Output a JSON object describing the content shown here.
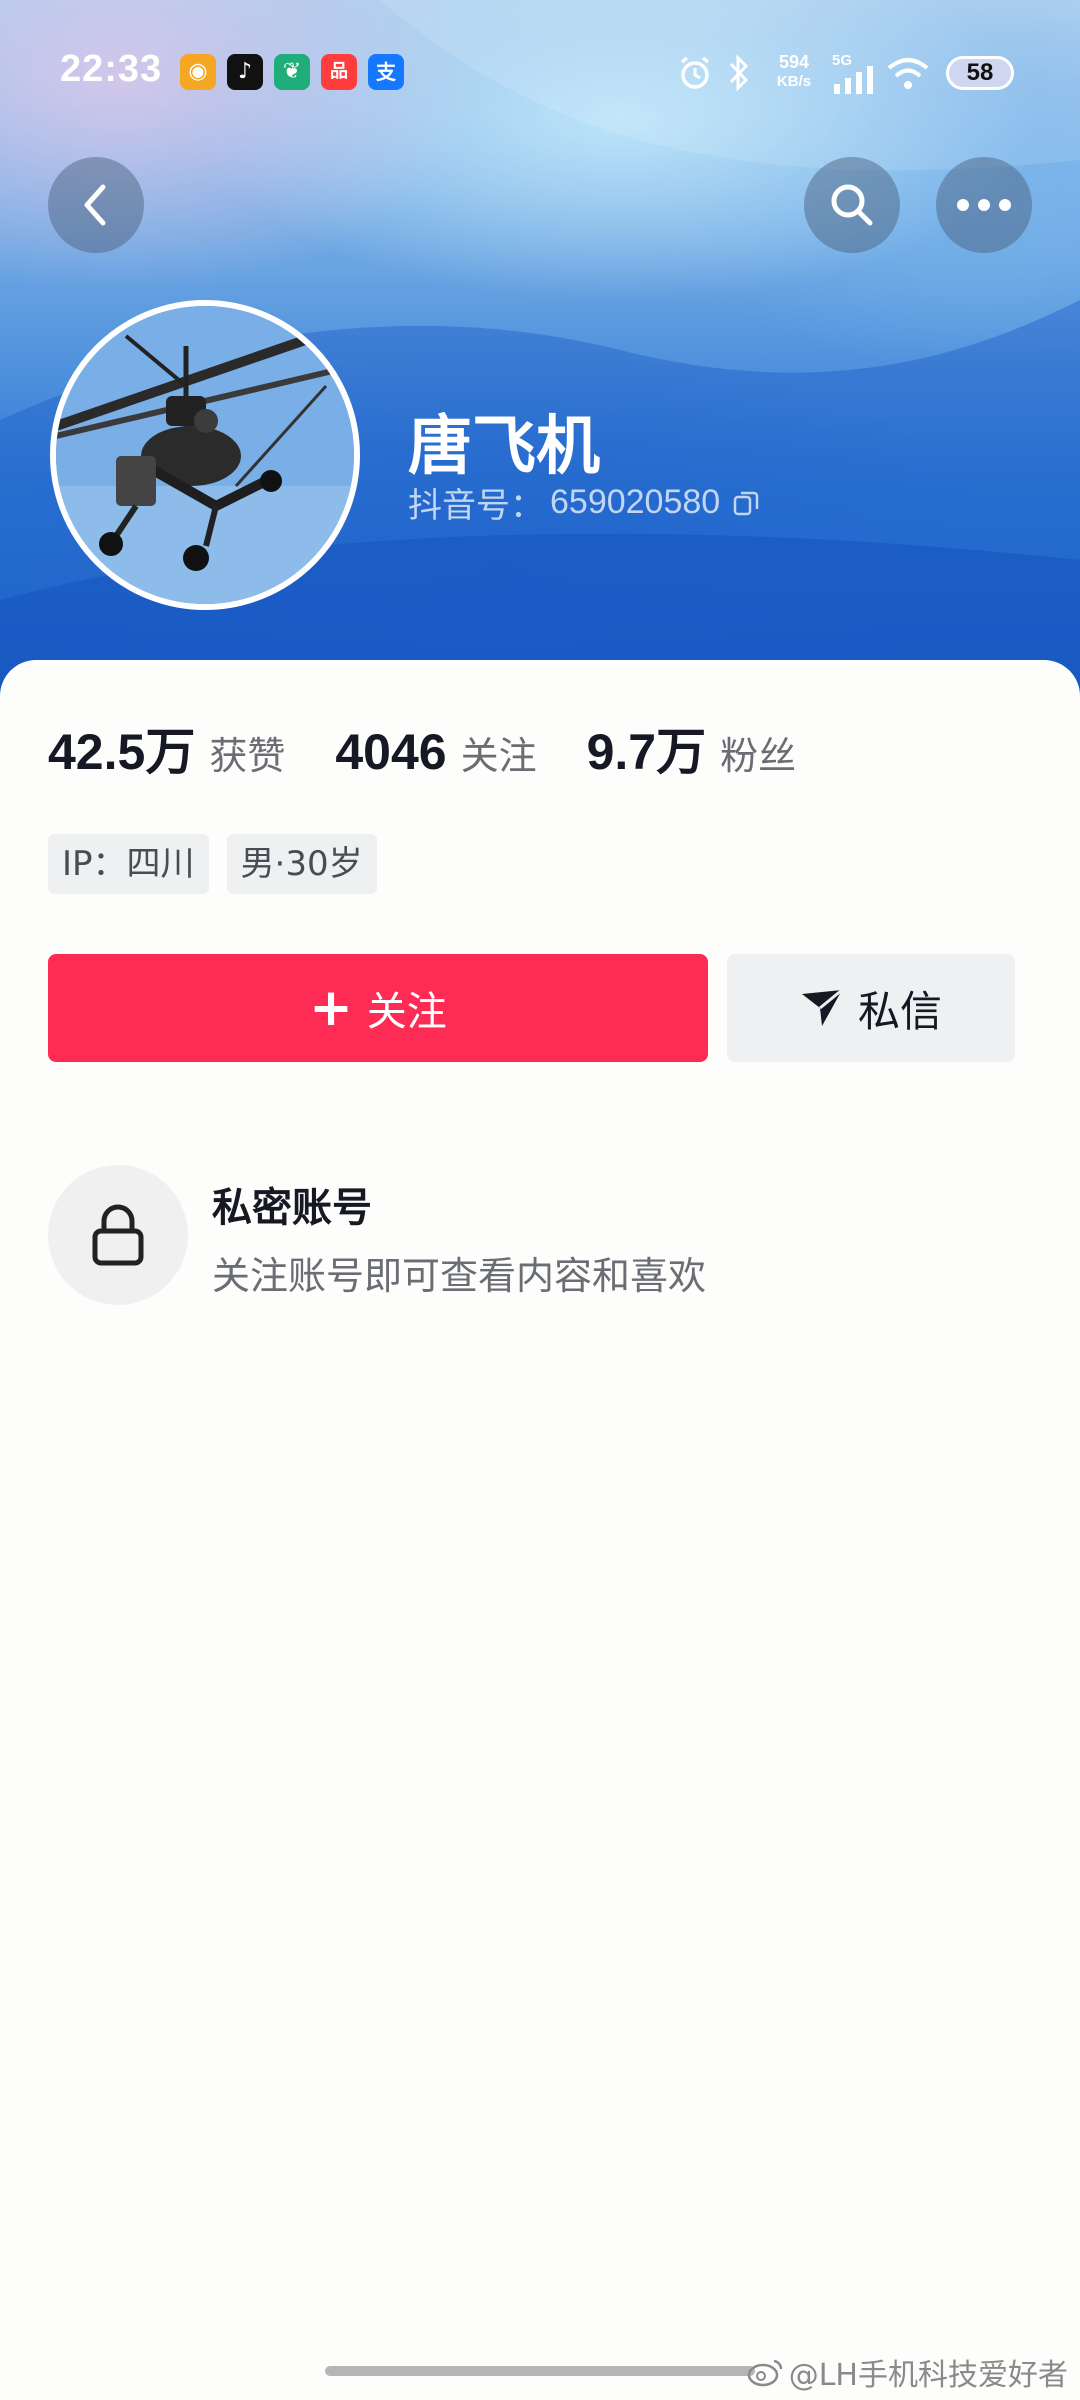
{
  "status_bar": {
    "time": "22:33",
    "apps": [
      {
        "name": "weibo-icon",
        "color": "#f5a623",
        "glyph": "◉"
      },
      {
        "name": "douyin-icon",
        "color": "#111111",
        "glyph": "♪"
      },
      {
        "name": "green-app-icon",
        "color": "#1fae7a",
        "glyph": "❦"
      },
      {
        "name": "red-app-icon",
        "color": "#ff3d3d",
        "glyph": "品"
      },
      {
        "name": "alipay-icon",
        "color": "#1677ff",
        "glyph": "支"
      }
    ],
    "net_speed_value": "594",
    "net_speed_unit": "KB/s",
    "network_type": "5G",
    "battery": "58"
  },
  "profile": {
    "nickname": "唐飞机",
    "id_label": "抖音号：",
    "id_value": "659020580"
  },
  "stats": [
    {
      "value": "42.5",
      "unit": "万",
      "label": "获赞"
    },
    {
      "value": "4046",
      "unit": "",
      "label": "关注"
    },
    {
      "value": "9.7",
      "unit": "万",
      "label": "粉丝"
    }
  ],
  "tags": [
    "IP：四川",
    "男·30岁"
  ],
  "actions": {
    "follow_plus": "+",
    "follow": "关注",
    "message": "私信"
  },
  "private_account": {
    "title": "私密账号",
    "description": "关注账号即可查看内容和喜欢"
  },
  "watermark": "@LH手机科技爱好者",
  "colors": {
    "accent": "#fe2c55",
    "header_blue": "#2f7ad6"
  }
}
